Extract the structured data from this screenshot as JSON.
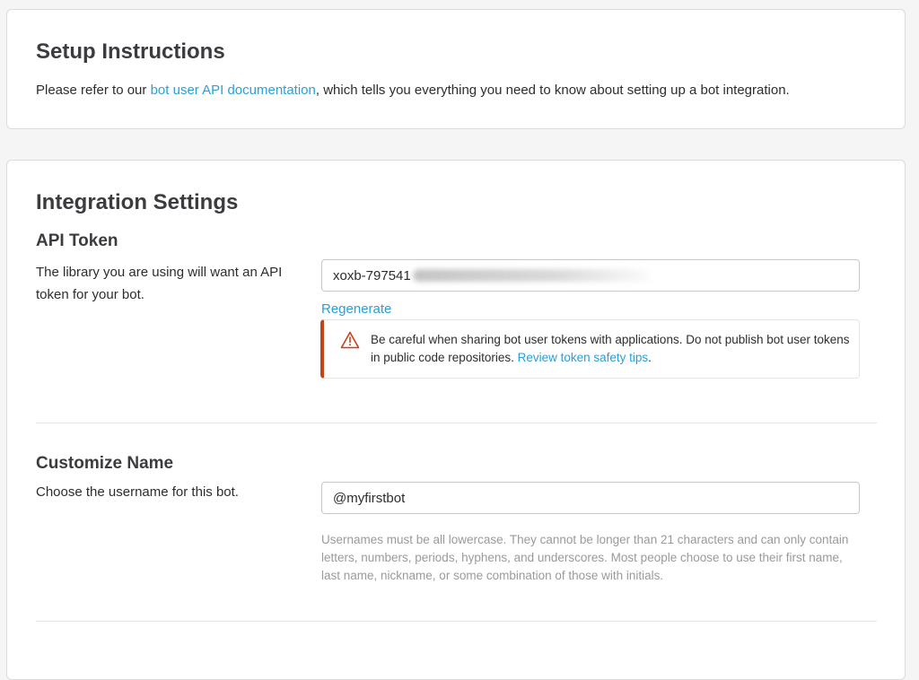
{
  "setup": {
    "title": "Setup Instructions",
    "desc_prefix": "Please refer to our ",
    "doc_link": "bot user API documentation",
    "desc_suffix": ", which tells you everything you need to know about setting up a bot integration."
  },
  "integration": {
    "title": "Integration Settings",
    "api_token": {
      "title": "API Token",
      "desc": "The library you are using will want an API token for your bot.",
      "value_visible": "xoxb-797541",
      "regenerate": "Regenerate",
      "warning_text": "Be careful when sharing bot user tokens with applications. Do not publish bot user tokens in public code repositories. ",
      "warning_link": "Review token safety tips",
      "warning_period": "."
    },
    "customize_name": {
      "title": "Customize Name",
      "desc": "Choose the username for this bot.",
      "username": "@myfirstbot",
      "help": "Usernames must be all lowercase. They cannot be longer than 21 characters and can only contain letters, numbers, periods, hyphens, and underscores. Most people choose to use their first name, last name, nickname, or some combination of those with initials."
    }
  },
  "colors": {
    "link": "#2a9fd6",
    "warning_accent": "#c1441d",
    "background": "#f5f5f5"
  },
  "icons": {
    "warning": "warning-triangle-icon"
  }
}
